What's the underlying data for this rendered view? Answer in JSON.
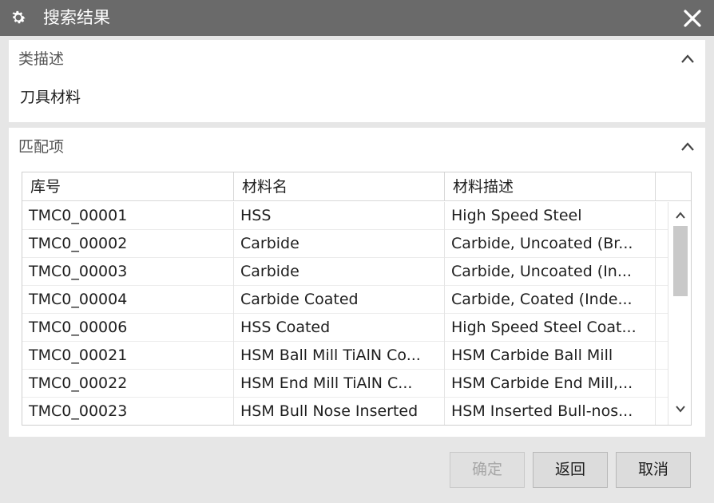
{
  "window": {
    "title": "搜索结果"
  },
  "class_description": {
    "header": "类描述",
    "value": "刀具材料"
  },
  "matches": {
    "header": "匹配项",
    "columns": [
      "库号",
      "材料名",
      "材料描述"
    ],
    "rows": [
      [
        "TMC0_00001",
        "HSS",
        "High Speed Steel"
      ],
      [
        "TMC0_00002",
        "Carbide",
        "Carbide, Uncoated (Br..."
      ],
      [
        "TMC0_00003",
        "Carbide",
        "Carbide, Uncoated (In..."
      ],
      [
        "TMC0_00004",
        "Carbide Coated",
        "Carbide, Coated (Inde..."
      ],
      [
        "TMC0_00006",
        "HSS Coated",
        "High Speed Steel Coat..."
      ],
      [
        "TMC0_00021",
        "HSM Ball Mill TiAlN Co...",
        "HSM Carbide Ball Mill"
      ],
      [
        "TMC0_00022",
        "HSM End Mill TiAlN C...",
        "HSM Carbide End Mill,..."
      ],
      [
        "TMC0_00023",
        "HSM Bull Nose Inserted",
        "HSM Inserted Bull-nos..."
      ]
    ]
  },
  "buttons": {
    "ok": "确定",
    "back": "返回",
    "cancel": "取消"
  },
  "icons": {
    "title": "gear-icon",
    "close": "close-icon",
    "collapse": "chevron-up-icon",
    "scroll_up": "scroll-up-icon",
    "scroll_down": "scroll-down-icon"
  }
}
